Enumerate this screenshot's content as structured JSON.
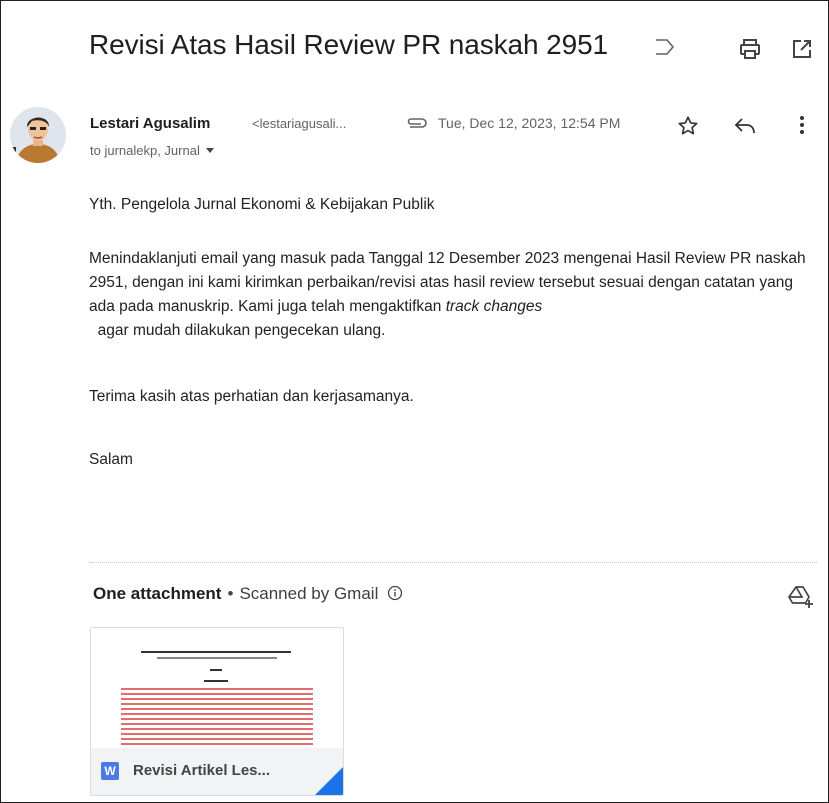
{
  "email": {
    "subject": "Revisi Atas Hasil Review PR naskah 2951",
    "sender_name": "Lestari Agusalim",
    "sender_email": "<lestariagusali...",
    "date": "Tue, Dec 12, 2023, 12:54 PM",
    "recipients": "to jurnalekp, Jurnal"
  },
  "body": {
    "greeting": "Yth. Pengelola Jurnal Ekonomi & Kebijakan Publik",
    "para_start": "Menindaklanjuti email yang masuk pada Tanggal 12 Desember 2023 mengenai Hasil Review PR naskah 2951, dengan ini kami kirimkan perbaikan/revisi atas hasil review tersebut sesuai dengan catatan yang ada pada manuskrip. Kami juga telah mengaktifkan ",
    "para_italic": "track changes",
    "para_end": "  agar mudah dilakukan pengecekan ulang.",
    "thanks": "Terima kasih atas perhatian dan kerjasamanya.",
    "closing": "Salam"
  },
  "attachments": {
    "heading": "One attachment",
    "separator": "•",
    "scanned": "Scanned by Gmail",
    "file_icon_letter": "W",
    "file_name": "Revisi Artikel Les..."
  },
  "icons": {
    "label": "label-icon",
    "print": "print-icon",
    "popout": "open-in-new-window-icon",
    "attachment": "paperclip-icon",
    "star": "star-icon",
    "reply": "reply-icon",
    "more": "more-vert-icon",
    "info": "info-icon",
    "drive": "add-to-drive-icon"
  },
  "colors": {
    "word_blue": "#4a7be5",
    "corner_blue": "#1a73e8",
    "tracked_change_red": "#e26d6d"
  }
}
